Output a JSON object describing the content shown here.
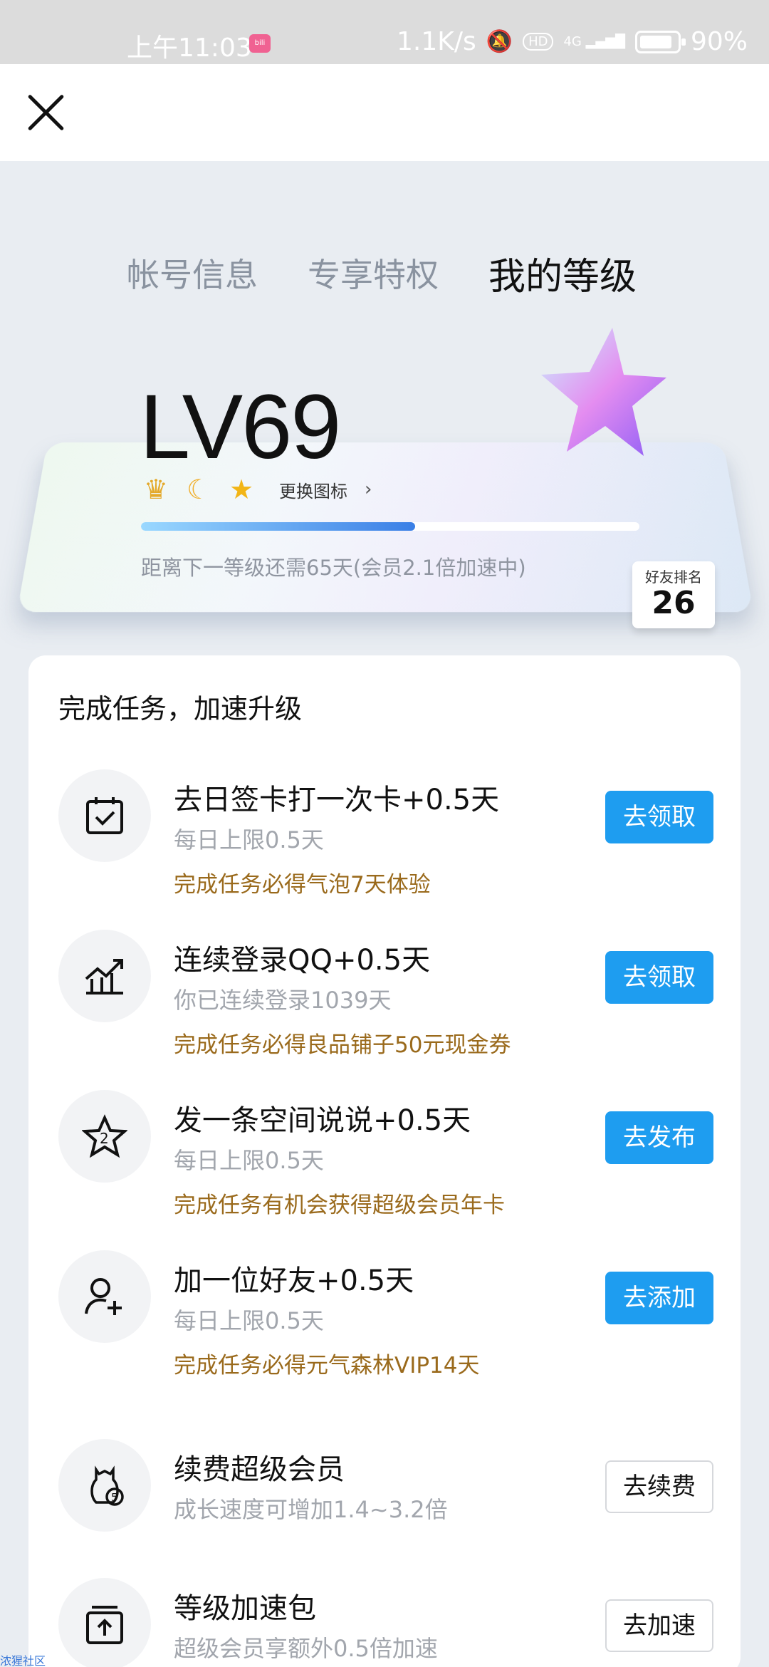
{
  "status": {
    "time": "上午11:03",
    "net_speed": "1.1K/s",
    "hd": "HD",
    "signal": "4G",
    "battery": "90%"
  },
  "tabs": [
    "帐号信息",
    "专享特权",
    "我的等级"
  ],
  "level": {
    "value": "LV69",
    "change_icon": "更换图标",
    "progress_fraction": 0.55,
    "remain_text": "距离下一等级还需65天(会员2.1倍加速中)",
    "rank_label": "好友排名",
    "rank_value": "26",
    "icons": [
      "crown-icon",
      "moon-icon",
      "star-icon"
    ]
  },
  "panel": {
    "title": "完成任务，加速升级",
    "tasks": [
      {
        "title": "去日签卡打一次卡+0.5天",
        "sub": "每日上限0.5天",
        "reward": "完成任务必得气泡7天体验",
        "button": "去领取",
        "icon": "calendar-check-icon"
      },
      {
        "title": "连续登录QQ+0.5天",
        "sub": "你已连续登录1039天",
        "reward": "完成任务必得良品铺子50元现金券",
        "button": "去领取",
        "icon": "trend-chart-icon"
      },
      {
        "title": "发一条空间说说+0.5天",
        "sub": "每日上限0.5天",
        "reward": "完成任务有机会获得超级会员年卡",
        "button": "去发布",
        "icon": "star-two-icon"
      },
      {
        "title": "加一位好友+0.5天",
        "sub": "每日上限0.5天",
        "reward": "完成任务必得元气森林VIP14天",
        "button": "去添加",
        "icon": "add-friend-icon"
      },
      {
        "title": "续费超级会员",
        "sub": "成长速度可增加1.4~3.2倍",
        "button": "去续费",
        "icon": "penguin-coin-icon"
      },
      {
        "title": "等级加速包",
        "sub": "超级会员享额外0.5倍加速",
        "button": "去加速",
        "icon": "upload-box-icon"
      }
    ]
  },
  "watermark": "浓猩社区",
  "colors": {
    "accent": "#1e9df0",
    "reward": "#9a6a1c",
    "background": "#e9edf2"
  }
}
